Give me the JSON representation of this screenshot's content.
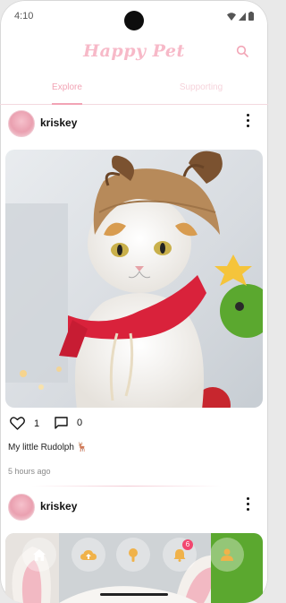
{
  "status_bar": {
    "time": "4:10",
    "icons": [
      "wifi-icon",
      "signal-icon",
      "battery-icon"
    ]
  },
  "header": {
    "title": "Happy Pet",
    "search_icon": "search-icon"
  },
  "tabs": [
    {
      "label": "Explore",
      "active": true
    },
    {
      "label": "Supporting",
      "active": false
    }
  ],
  "posts": [
    {
      "username": "kriskey",
      "photo": "cat-in-reindeer-hat",
      "likes": "1",
      "comments": "0",
      "caption": "My little Rudolph 🦌",
      "time_ago": "5 hours ago"
    },
    {
      "username": "kriskey",
      "photo": "bunny-ears"
    }
  ],
  "bottom_nav": {
    "items": [
      "home-icon",
      "upload-icon",
      "pet-icon",
      "notifications-icon",
      "profile-icon"
    ],
    "badge_count": "6"
  },
  "colors": {
    "accent_pink": "#f2a4b5",
    "badge": "#f2476f",
    "nav_icon": "#ffffff"
  }
}
